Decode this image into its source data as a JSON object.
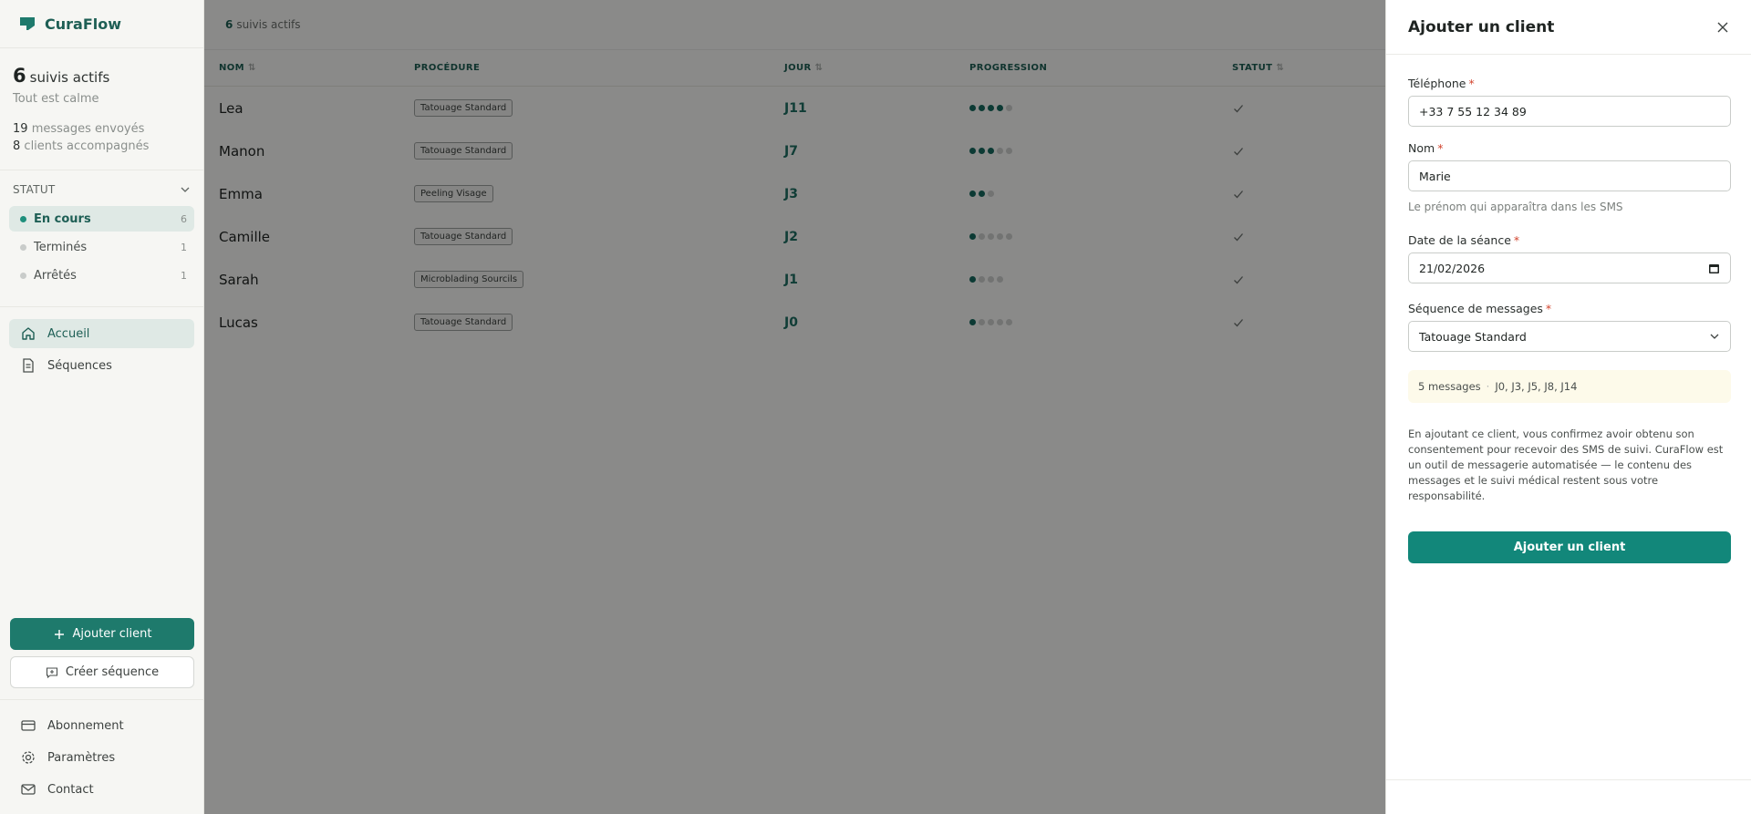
{
  "brand": {
    "name": "CuraFlow"
  },
  "stats": {
    "active_count": "6",
    "active_label": "suivis actifs",
    "calm": "Tout est calme",
    "messages_count": "19",
    "messages_label": "messages envoyés",
    "clients_count": "8",
    "clients_label": "clients accompagnés"
  },
  "status_filter": {
    "heading": "STATUT",
    "items": [
      {
        "label": "En cours",
        "count": "6"
      },
      {
        "label": "Terminés",
        "count": "1"
      },
      {
        "label": "Arrêtés",
        "count": "1"
      }
    ]
  },
  "nav": {
    "home": "Accueil",
    "sequences": "Séquences",
    "subscription": "Abonnement",
    "settings": "Paramètres",
    "contact": "Contact"
  },
  "side_actions": {
    "add_client": "Ajouter client",
    "create_sequence": "Créer séquence"
  },
  "topbar": {
    "count": "6",
    "label": "suivis actifs"
  },
  "table": {
    "headers": {
      "name": "NOM",
      "procedure": "PROCÉDURE",
      "day": "JOUR",
      "progress": "PROGRESSION",
      "status": "STATUT"
    },
    "rows": [
      {
        "name": "Lea",
        "procedure": "Tatouage Standard",
        "day": "J11",
        "progress_done": 4,
        "progress_total": 5
      },
      {
        "name": "Manon",
        "procedure": "Tatouage Standard",
        "day": "J7",
        "progress_done": 3,
        "progress_total": 5
      },
      {
        "name": "Emma",
        "procedure": "Peeling Visage",
        "day": "J3",
        "progress_done": 2,
        "progress_total": 3
      },
      {
        "name": "Camille",
        "procedure": "Tatouage Standard",
        "day": "J2",
        "progress_done": 1,
        "progress_total": 5
      },
      {
        "name": "Sarah",
        "procedure": "Microblading Sourcils",
        "day": "J1",
        "progress_done": 1,
        "progress_total": 4
      },
      {
        "name": "Lucas",
        "procedure": "Tatouage Standard",
        "day": "J0",
        "progress_done": 1,
        "progress_total": 5
      }
    ]
  },
  "drawer": {
    "title": "Ajouter un client",
    "phone_label": "Téléphone",
    "phone_value": "+33 7 55 12 34 89",
    "name_label": "Nom",
    "name_value": "Marie",
    "name_hint": "Le prénom qui apparaîtra dans les SMS",
    "date_label": "Date de la séance",
    "date_value": "21/02/2026",
    "sequence_label": "Séquence de messages",
    "sequence_value": "Tatouage Standard",
    "sequence_messages": "5 messages",
    "sequence_days": "J0, J3, J5, J8, J14",
    "consent": "En ajoutant ce client, vous confirmez avoir obtenu son consentement pour recevoir des SMS de suivi. CuraFlow est un outil de messagerie automatisée — le contenu des messages et le suivi médical restent sous votre responsabilité.",
    "submit": "Ajouter un client",
    "required_mark": "*"
  },
  "colors": {
    "brand": "#1e7a6c",
    "accent": "#12877a",
    "required": "#d2452f"
  }
}
